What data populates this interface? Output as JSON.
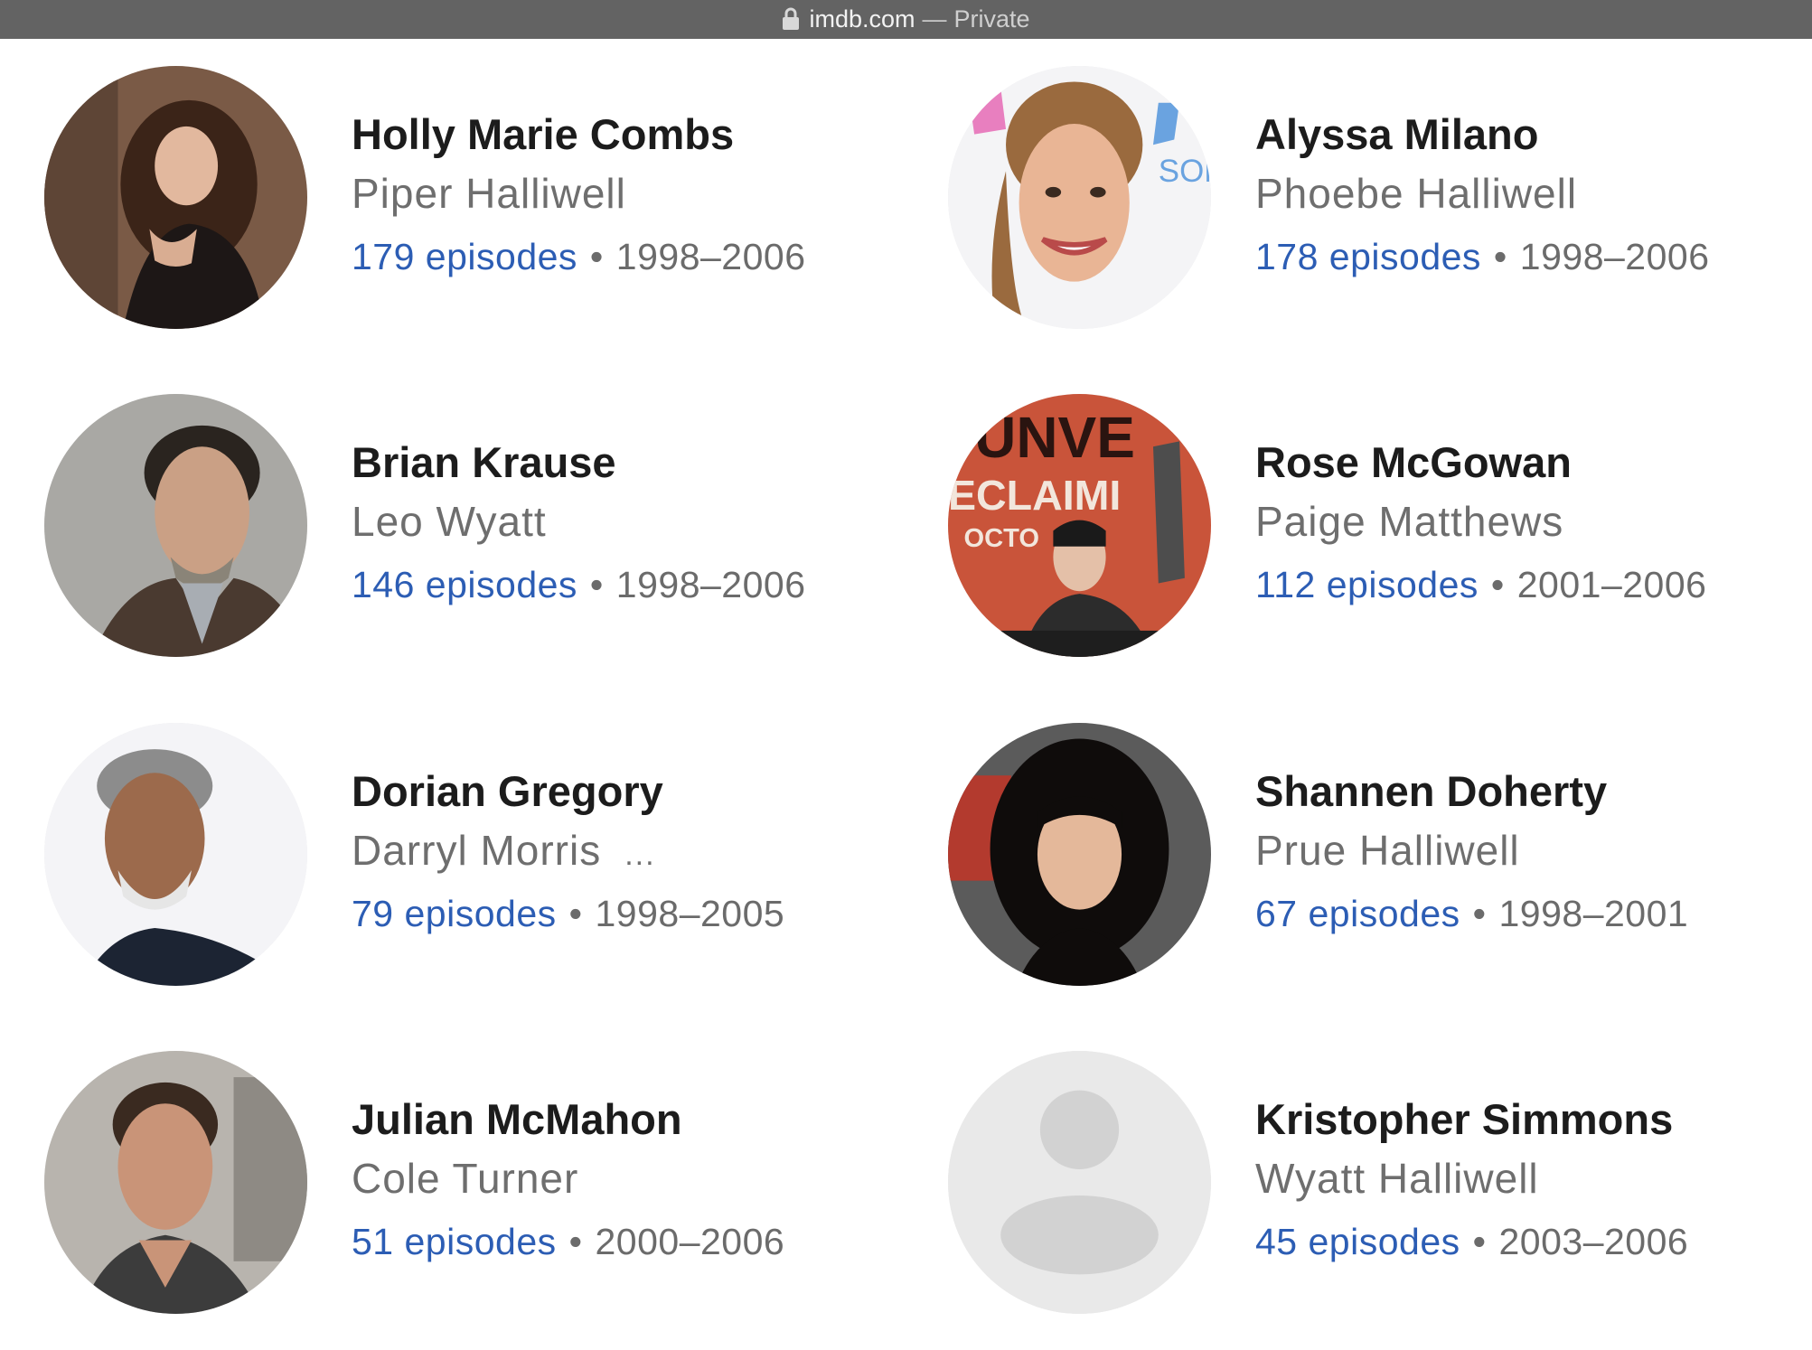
{
  "browser": {
    "domain": "imdb.com",
    "separator": "—",
    "mode": "Private"
  },
  "colors": {
    "link": "#2c5db4",
    "name": "#1c1c1c",
    "secondary": "#6e6e6e",
    "topbar": "#636363"
  },
  "cast": [
    {
      "name": "Holly Marie Combs",
      "role": "Piper Halliwell",
      "episodes": "179 episodes",
      "years": "1998–2006",
      "more": ""
    },
    {
      "name": "Alyssa Milano",
      "role": "Phoebe Halliwell",
      "episodes": "178 episodes",
      "years": "1998–2006",
      "more": ""
    },
    {
      "name": "Brian Krause",
      "role": "Leo Wyatt",
      "episodes": "146 episodes",
      "years": "1998–2006",
      "more": ""
    },
    {
      "name": "Rose McGowan",
      "role": "Paige Matthews",
      "episodes": "112 episodes",
      "years": "2001–2006",
      "more": ""
    },
    {
      "name": "Dorian Gregory",
      "role": "Darryl Morris",
      "episodes": "79 episodes",
      "years": "1998–2005",
      "more": "..."
    },
    {
      "name": "Shannen Doherty",
      "role": "Prue Halliwell",
      "episodes": "67 episodes",
      "years": "1998–2001",
      "more": ""
    },
    {
      "name": "Julian McMahon",
      "role": "Cole Turner",
      "episodes": "51 episodes",
      "years": "2000–2006",
      "more": ""
    },
    {
      "name": "Kristopher Simmons",
      "role": "Wyatt Halliwell",
      "episodes": "45 episodes",
      "years": "2003–2006",
      "more": ""
    }
  ]
}
